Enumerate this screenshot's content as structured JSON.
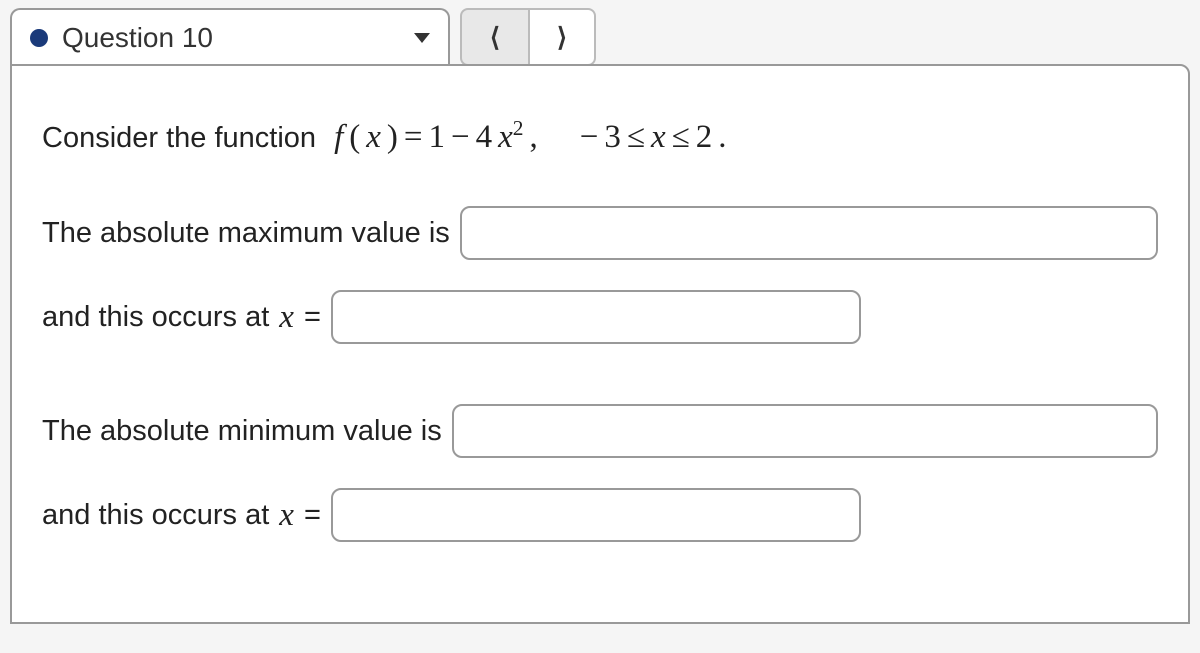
{
  "header": {
    "question_label": "Question 10"
  },
  "problem": {
    "intro": "Consider the function",
    "func_lhs_f": "f",
    "func_lhs_paren_open": "(",
    "func_lhs_x": "x",
    "func_lhs_paren_close": ")",
    "func_eq": "=",
    "func_rhs_1": "1",
    "func_rhs_minus": "−",
    "func_rhs_4": "4",
    "func_rhs_x": "x",
    "func_rhs_exp": "2",
    "func_rhs_comma": ",",
    "domain_neg": "−",
    "domain_lo": "3",
    "domain_le1": "≤",
    "domain_x": "x",
    "domain_le2": "≤",
    "domain_hi": "2",
    "domain_period": "."
  },
  "q1": {
    "label": "The absolute maximum value is",
    "value": ""
  },
  "q2": {
    "prefix": "and this occurs at",
    "var": "x",
    "eq": "=",
    "value": ""
  },
  "q3": {
    "label": "The absolute minimum value is",
    "value": ""
  },
  "q4": {
    "prefix": "and this occurs at",
    "var": "x",
    "eq": "=",
    "value": ""
  }
}
